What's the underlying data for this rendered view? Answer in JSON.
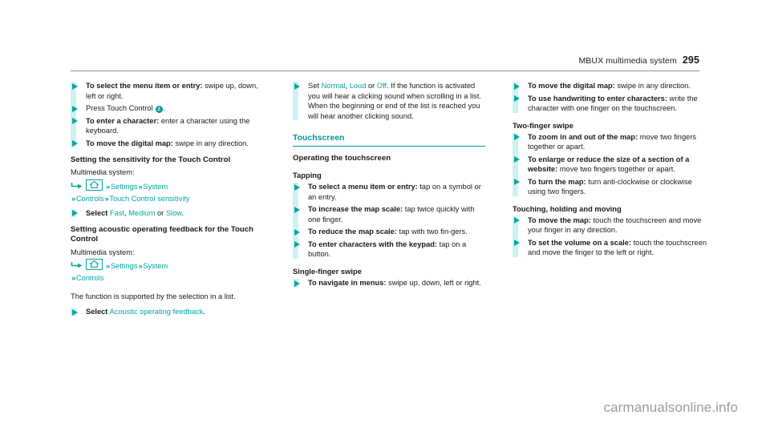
{
  "header": {
    "running_title": "MBUX multimedia system",
    "page_number": "295"
  },
  "column1": {
    "list1": [
      {
        "bold": "To select the menu item or entry:",
        "rest": " swipe up, down, left or right."
      },
      {
        "bold": "",
        "rest": "Press Touch Control ",
        "badge": "2",
        "after": "."
      },
      {
        "bold": "To enter a character:",
        "rest": " enter a character using the keyboard."
      },
      {
        "bold": "To move the digital map:",
        "rest": " swipe in any direction."
      }
    ],
    "heading1": "Setting the sensitivity for the Touch Control",
    "subline1": "Multimedia system:",
    "path1": [
      "Settings",
      "System",
      "Controls",
      "Touch Control sensitivity"
    ],
    "list2_select_label": "Select",
    "list2_options": [
      "Fast",
      "Medium",
      "Slow"
    ],
    "list2_or": "or",
    "heading2": "Setting acoustic operating feedback for the Touch Control",
    "subline2": "Multimedia system:",
    "path2": [
      "Settings",
      "System",
      "Controls"
    ],
    "para1": "The function is supported by the selection in a list.",
    "list3_select_label": "Select",
    "list3_value": "Acoustic operating feedback",
    "list3_period": "."
  },
  "column2": {
    "set_label": "Set",
    "set_options": [
      "Normal",
      "Loud",
      "Off"
    ],
    "set_or": "or",
    "set_period": ".",
    "set_detail": "If the function is activated you will hear a clicking sound when scrolling in a list. When the beginning or end of the list is reached you will hear another clicking sound.",
    "section_title": "Touchscreen",
    "heading1": "Operating the touchscreen",
    "heading2": "Tapping",
    "list1": [
      {
        "bold": "To select a menu item or entry:",
        "rest": " tap on a symbol or an entry."
      },
      {
        "bold": "To increase the map scale:",
        "rest": " tap twice quickly with one finger."
      },
      {
        "bold": "To reduce the map scale:",
        "rest": " tap with two fin-gers."
      },
      {
        "bold": "To enter characters with the keypad:",
        "rest": " tap on a button."
      }
    ],
    "heading3": "Single-finger swipe",
    "list2": [
      {
        "bold": "To navigate in menus:",
        "rest": " swipe up, down, left or right."
      }
    ]
  },
  "column3": {
    "list1": [
      {
        "bold": "To move the digital map:",
        "rest": " swipe in any direction."
      },
      {
        "bold": "To use handwriting to enter characters:",
        "rest": " write the character with one finger on the touchscreen."
      }
    ],
    "heading1": "Two-finger swipe",
    "list2": [
      {
        "bold": "To zoom in and out of the map:",
        "rest": " move two fingers together or apart."
      },
      {
        "bold": "To enlarge or reduce the size of a section of a website:",
        "rest": " move two fingers together or apart."
      },
      {
        "bold": "To turn the map:",
        "rest": " turn anti-clockwise or clockwise using two fingers."
      }
    ],
    "heading2": "Touching, holding and moving",
    "list3": [
      {
        "bold": "To move the map:",
        "rest": " touch the touchscreen and move your finger in any direction."
      },
      {
        "bold": "To set the volume on a scale:",
        "rest": " touch the touchscreen and move the finger to the left or right."
      }
    ]
  },
  "watermark": "carmanualsonline.info",
  "colors": {
    "accent_teal": "#00a79d",
    "heading_teal": "#009a93",
    "rail_cyan": "#cdf2f0",
    "rule_gray": "#8c9396",
    "watermark_gray": "#9c9c9c"
  },
  "icons": {
    "home": "home-icon",
    "path_start": "enter-arrow-icon",
    "chevron": "double-chevron-right-icon",
    "bullet": "triangle-bullet-icon"
  }
}
